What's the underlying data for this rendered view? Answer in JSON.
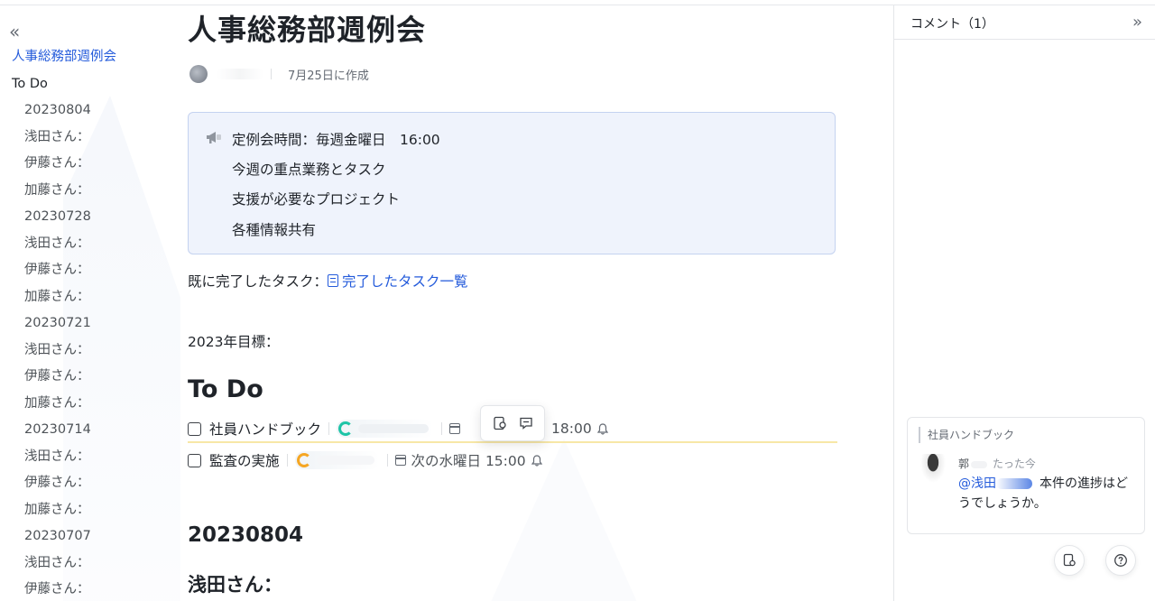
{
  "sidebar": {
    "items": [
      {
        "label": "人事総務部週例会",
        "level": 1,
        "active": true
      },
      {
        "label": "To Do",
        "level": 1,
        "active": false
      },
      {
        "label": "20230804",
        "level": 2
      },
      {
        "label": "浅田さん：",
        "level": 2
      },
      {
        "label": "伊藤さん：",
        "level": 2
      },
      {
        "label": "加藤さん：",
        "level": 2
      },
      {
        "label": "20230728",
        "level": 2
      },
      {
        "label": "浅田さん：",
        "level": 2
      },
      {
        "label": "伊藤さん：",
        "level": 2
      },
      {
        "label": "加藤さん：",
        "level": 2
      },
      {
        "label": "20230721",
        "level": 2
      },
      {
        "label": "浅田さん：",
        "level": 2
      },
      {
        "label": "伊藤さん：",
        "level": 2
      },
      {
        "label": "加藤さん：",
        "level": 2
      },
      {
        "label": "20230714",
        "level": 2
      },
      {
        "label": "浅田さん：",
        "level": 2
      },
      {
        "label": "伊藤さん：",
        "level": 2
      },
      {
        "label": "加藤さん：",
        "level": 2
      },
      {
        "label": "20230707",
        "level": 2
      },
      {
        "label": "浅田さん：",
        "level": 2
      },
      {
        "label": "伊藤さん：",
        "level": 2
      }
    ]
  },
  "doc": {
    "title": "人事総務部週例会",
    "created": "7月25日に作成",
    "callout": {
      "icon": "megaphone-icon",
      "lines": [
        "定例会時間：毎週金曜日　16:00",
        "今週の重点業務とタスク",
        "支援が必要なプロジェクト",
        "各種情報共有"
      ]
    },
    "done_label": "既に完了したタスク：",
    "done_link": "完了したタスク一覧",
    "goal": "2023年目標：",
    "todo_heading": "To Do",
    "tasks": [
      {
        "title": "社員ハンドブック",
        "due": "18:00",
        "checked": false
      },
      {
        "title": "監査の実施",
        "due": "次の水曜日 15:00",
        "checked": false
      }
    ],
    "heading_date": "20230804",
    "heading_person": "浅田さん："
  },
  "comments": {
    "title": "コメント（1）",
    "card": {
      "quote": "社員ハンドブック",
      "author": "郭",
      "time": "たった今",
      "mention": "@浅田",
      "text": "本件の進捗はどうでしょうか。"
    }
  },
  "colors": {
    "accent": "#245bdb",
    "callout_bg": "#eff3fc",
    "callout_border": "#c4d2f0"
  }
}
